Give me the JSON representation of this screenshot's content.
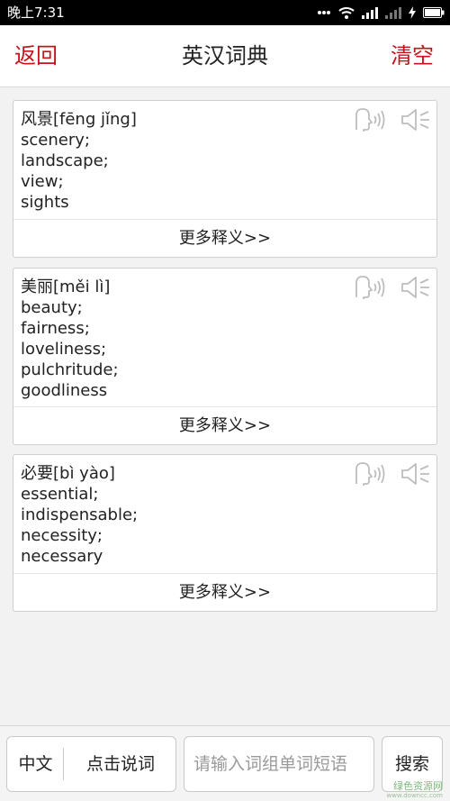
{
  "status_bar": {
    "time": "晚上7:31",
    "icons": [
      "more-dots-icon",
      "wifi-icon",
      "signal-icon",
      "signal-empty-icon",
      "charging-icon",
      "battery-icon"
    ]
  },
  "header": {
    "back_label": "返回",
    "title": "英汉词典",
    "clear_label": "清空",
    "accent_color": "#c9121b"
  },
  "entries": [
    {
      "word": "风景[fēng jǐng]",
      "definitions": [
        "scenery;",
        "landscape;",
        "view;",
        "sights"
      ],
      "more_label": "更多释义>>"
    },
    {
      "word": "美丽[měi lì]",
      "definitions": [
        "beauty;",
        "fairness;",
        "loveliness;",
        "pulchritude;",
        "goodliness"
      ],
      "more_label": "更多释义>>"
    },
    {
      "word": "必要[bì yào]",
      "definitions": [
        "essential;",
        "indispensable;",
        "necessity;",
        "necessary"
      ],
      "more_label": "更多释义>>"
    }
  ],
  "bottom_bar": {
    "language_label": "中文",
    "voice_label": "点击说词",
    "search_placeholder": "请输入词组单词短语",
    "search_value": "",
    "search_label": "搜索"
  },
  "watermark": {
    "text_cn": "绿色资源网",
    "text_en": "www.downcc.com"
  }
}
